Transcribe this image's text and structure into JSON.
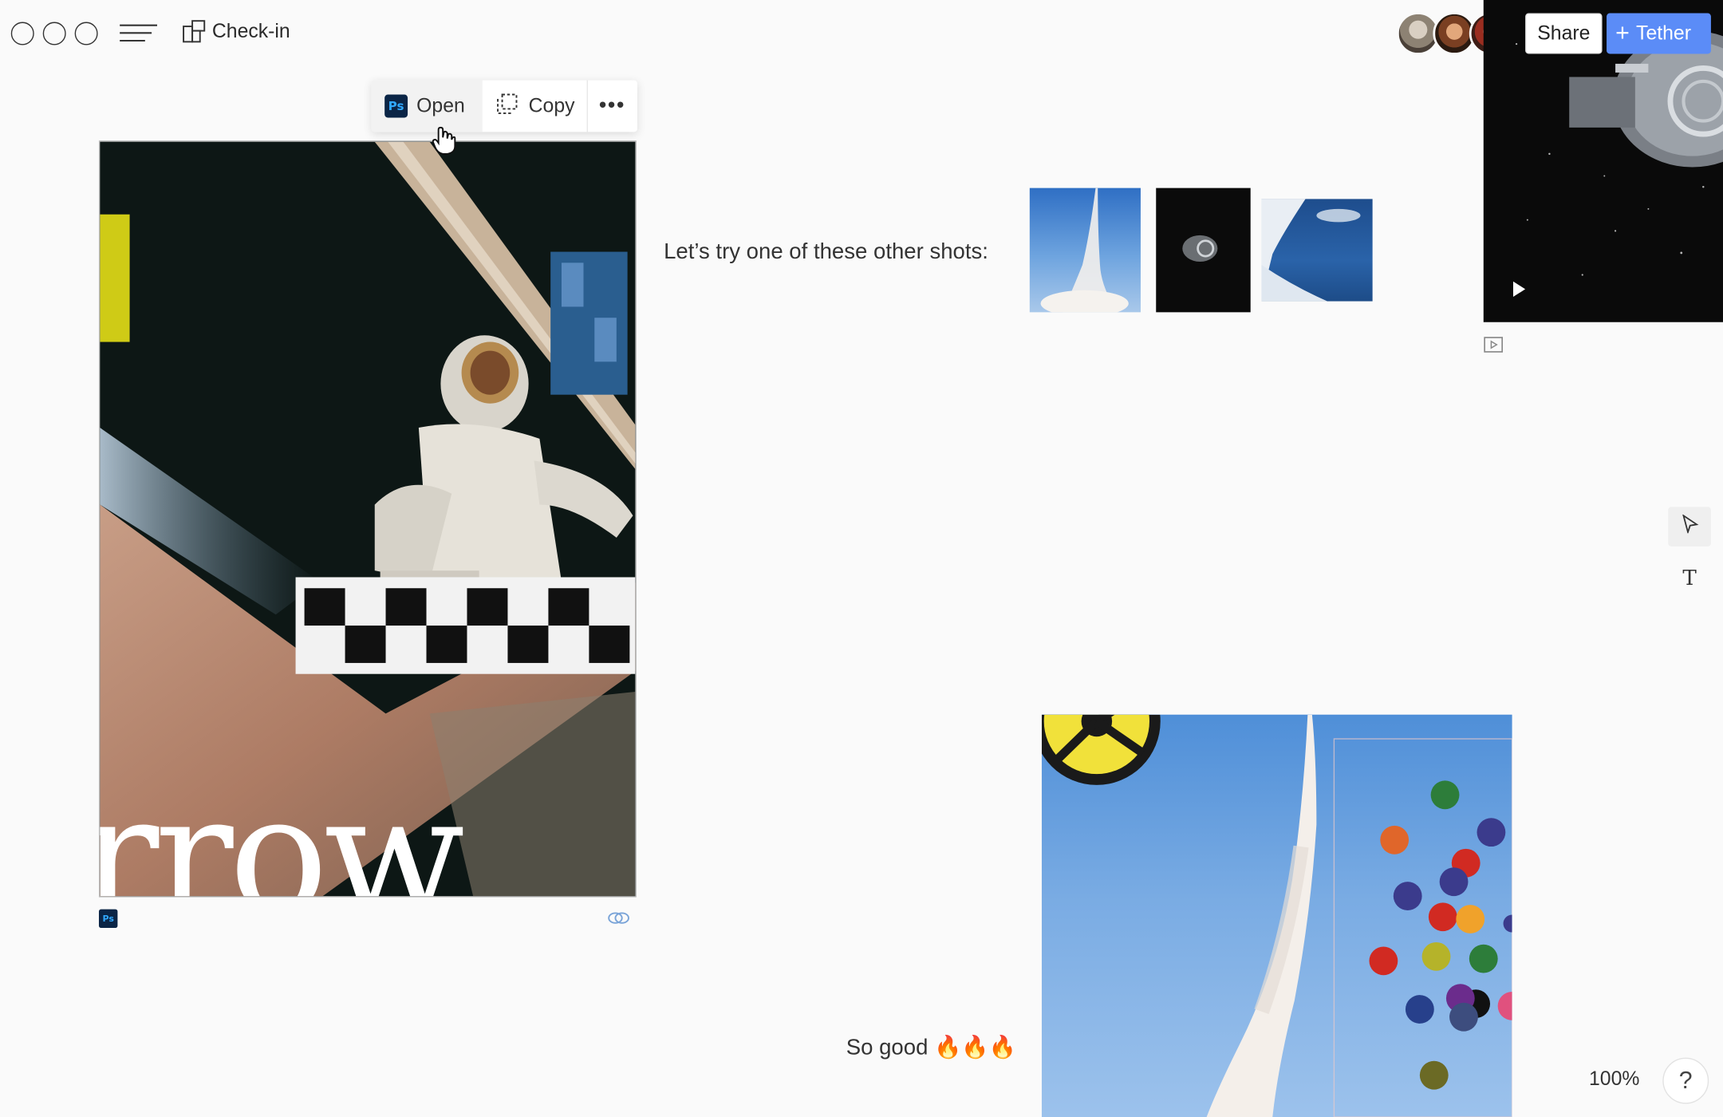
{
  "window": {
    "controls": [
      "close",
      "minimize",
      "maximize"
    ]
  },
  "header": {
    "menu_icon": "hamburger-menu-icon",
    "board_icon": "board-layout-icon",
    "board_title": "Check-in",
    "share_label": "Share",
    "tether_label": "Tether",
    "accent_color": "#5b8cf7"
  },
  "collaborators": [
    "avatar-1",
    "avatar-2",
    "avatar-3"
  ],
  "context_toolbar": {
    "open_label": "Open",
    "open_app_badge": "Ps",
    "copy_label": "Copy",
    "more_label": "•••"
  },
  "main_image": {
    "overlay_text": "rrow",
    "app_badge": "Ps"
  },
  "captions": {
    "first": "Let’s try one of these other shots:",
    "second": "So good 🔥🔥🔥"
  },
  "tools": {
    "select_icon": "pointer-icon",
    "text_label": "T"
  },
  "footer": {
    "zoom": "100%",
    "help_label": "?"
  }
}
